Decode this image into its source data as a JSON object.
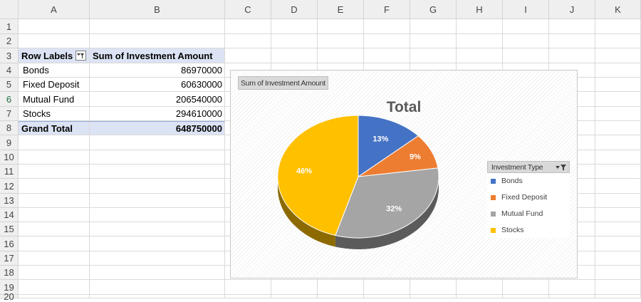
{
  "columns": [
    "A",
    "B",
    "C",
    "D",
    "E",
    "F",
    "G",
    "H",
    "I",
    "J",
    "K"
  ],
  "rows": [
    "1",
    "2",
    "3",
    "4",
    "5",
    "6",
    "7",
    "8",
    "9",
    "10",
    "11",
    "12",
    "13",
    "14",
    "15",
    "16",
    "17",
    "18",
    "19",
    "20"
  ],
  "pivot": {
    "header_labels": "Row Labels",
    "header_sum": "Sum of  Investment Amount",
    "items": [
      {
        "label": "Bonds",
        "value": "86970000"
      },
      {
        "label": "Fixed Deposit",
        "value": "60630000"
      },
      {
        "label": "Mutual Fund",
        "value": "206540000"
      },
      {
        "label": "Stocks",
        "value": "294610000"
      }
    ],
    "total_label": "Grand Total",
    "total_value": "648750000"
  },
  "chart": {
    "field_button": "Sum of  Investment Amount",
    "legend_header": "Investment Type"
  },
  "chart_data": {
    "type": "pie",
    "title": "Total",
    "categories": [
      "Bonds",
      "Fixed Deposit",
      "Mutual Fund",
      "Stocks"
    ],
    "values": [
      86970000,
      60630000,
      206540000,
      294610000
    ],
    "labels": [
      "13%",
      "9%",
      "32%",
      "46%"
    ],
    "colors": [
      "#4472c4",
      "#ed7d31",
      "#a5a5a5",
      "#ffc000"
    ],
    "legend_position": "right"
  }
}
